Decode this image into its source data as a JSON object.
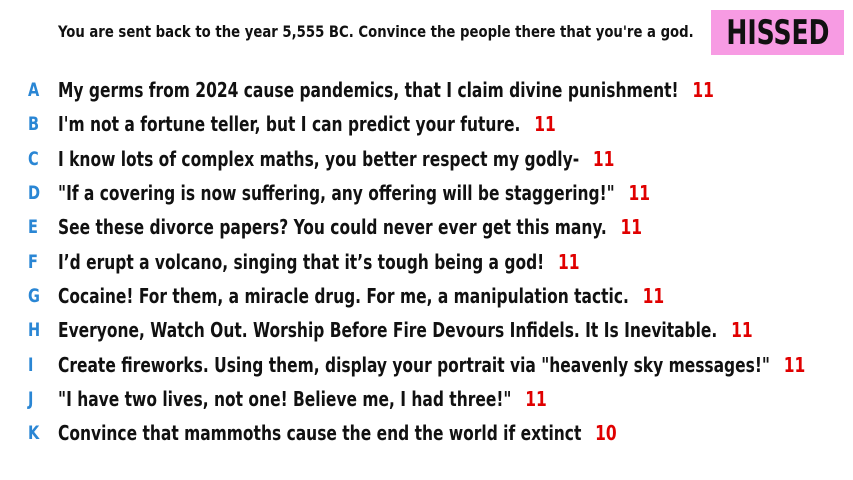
{
  "prompt": "You are sent back to the year 5,555 BC. Convince the people there that you're a god.",
  "badge": "HISSED",
  "colors": {
    "letter": "#2a86d4",
    "score": "#e00000",
    "badge_bg": "#f79be3"
  },
  "answers": [
    {
      "letter": "A",
      "text": "My germs from 2024 cause pandemics, that I claim divine punishment!",
      "score": "11"
    },
    {
      "letter": "B",
      "text": "I'm not a fortune teller, but I can predict your future.",
      "score": "11"
    },
    {
      "letter": "C",
      "text": "I know lots of complex maths, you better respect my godly-",
      "score": "11"
    },
    {
      "letter": "D",
      "text": "\"If a covering is now suffering, any offering will be staggering!\"",
      "score": "11"
    },
    {
      "letter": "E",
      "text": "See these divorce papers? You could never ever get this many.",
      "score": "11"
    },
    {
      "letter": "F",
      "text": "I’d erupt a volcano, singing that it’s tough being a god!",
      "score": "11"
    },
    {
      "letter": "G",
      "text": "Cocaine! For them, a miracle drug. For me, a manipulation tactic.",
      "score": "11"
    },
    {
      "letter": "H",
      "text": "Everyone, Watch Out. Worship Before Fire Devours Infidels. It Is Inevitable.",
      "score": "11"
    },
    {
      "letter": "I",
      "text": "Create fireworks. Using them, display your portrait via \"heavenly sky messages!\"",
      "score": "11"
    },
    {
      "letter": "J",
      "text": "\"I have two lives, not one! Believe me, I had three!\"",
      "score": "11"
    },
    {
      "letter": "K",
      "text": "Convince that mammoths cause the end the world if extinct",
      "score": "10"
    }
  ]
}
